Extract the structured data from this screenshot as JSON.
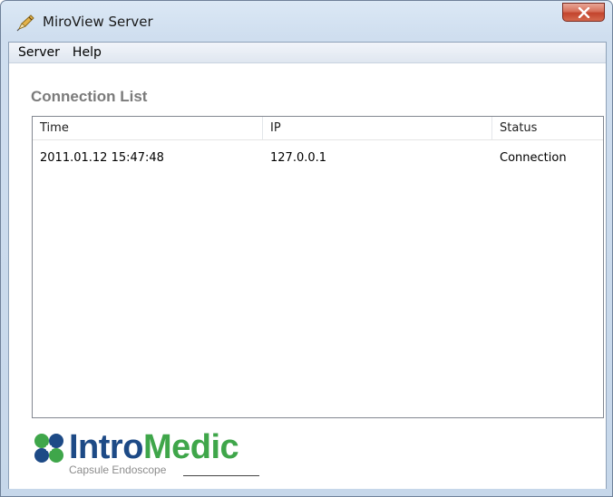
{
  "window": {
    "title": "MiroView Server",
    "app_icon": "pen-icon"
  },
  "menu": {
    "items": [
      "Server",
      "Help"
    ]
  },
  "section_title": "Connection List",
  "connection_list": {
    "columns": [
      "Time",
      "IP",
      "Status"
    ],
    "rows": [
      {
        "time": "2011.01.12 15:47:48",
        "ip": "127.0.0.1",
        "status": "Connection"
      }
    ]
  },
  "logo": {
    "brand_part1": "Intro",
    "brand_part2": "Medic",
    "tagline": "Capsule Endoscope",
    "colors": {
      "blue": "#1d4a86",
      "green": "#3fa64a"
    }
  }
}
